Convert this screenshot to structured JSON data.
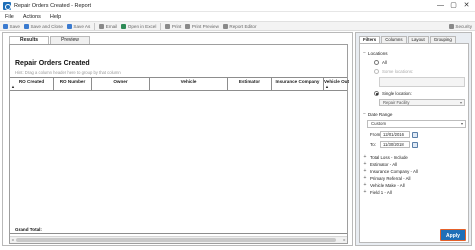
{
  "window": {
    "title": "Repair Orders Created - Report",
    "controls": [
      "—",
      "▢",
      "✕"
    ]
  },
  "menu": [
    "File",
    "Actions",
    "Help"
  ],
  "toolbar": {
    "items": [
      {
        "label": "Save",
        "icon": "save-icon",
        "color": "#3b7bd0"
      },
      {
        "label": "Save and Close",
        "icon": "save-close-icon",
        "color": "#3b7bd0"
      },
      {
        "label": "Save As",
        "icon": "save-as-icon",
        "color": "#3b7bd0"
      },
      {
        "label": "Email",
        "icon": "email-icon",
        "color": "#8a8a8a"
      },
      {
        "label": "Open in Excel",
        "icon": "excel-icon",
        "color": "#2e8b57"
      },
      {
        "label": "Print",
        "icon": "print-icon",
        "color": "#8a8a8a"
      },
      {
        "label": "Print Preview",
        "icon": "print-preview-icon",
        "color": "#8a8a8a"
      },
      {
        "label": "Report Editor",
        "icon": "report-editor-icon",
        "color": "#8a8a8a"
      }
    ],
    "security_label": "Security"
  },
  "main": {
    "tabs": [
      "Results",
      "Preview"
    ],
    "active_tab": "Results",
    "report_title": "Repair Orders Created",
    "group_hint": "Hint: Drag a column header here to group by that column",
    "columns": [
      "RO Created",
      "RO Number",
      "Owner",
      "Vehicle",
      "Estimator",
      "Insurance Company",
      "Vehicle Out"
    ],
    "grand_total_label": "Grand Total:"
  },
  "filters_panel": {
    "tabs": [
      "Filters",
      "Columns",
      "Layout",
      "Grouping"
    ],
    "active_tab": "Filters",
    "locations": {
      "heading": "Locations",
      "all_label": "All",
      "some_label": "Some locations:",
      "single_label": "Single location:",
      "single_value": "Repair Facility",
      "selected": "single"
    },
    "date_range": {
      "heading": "Date Range",
      "preset": "Custom",
      "from_label": "From:",
      "from_value": "12/01/2016",
      "to_label": "To:",
      "to_value": "11/30/2018"
    },
    "filter_items": [
      "Total Loss - Include",
      "Estimator - All",
      "Insurance Company - All",
      "Primary Referral - All",
      "Vehicle Make - All",
      "Field 1 - All"
    ],
    "apply_label": "Apply"
  },
  "colors": {
    "accent": "#1f6fb8",
    "apply_outline": "#e5612a",
    "panel_bg": "#e9edf2"
  }
}
